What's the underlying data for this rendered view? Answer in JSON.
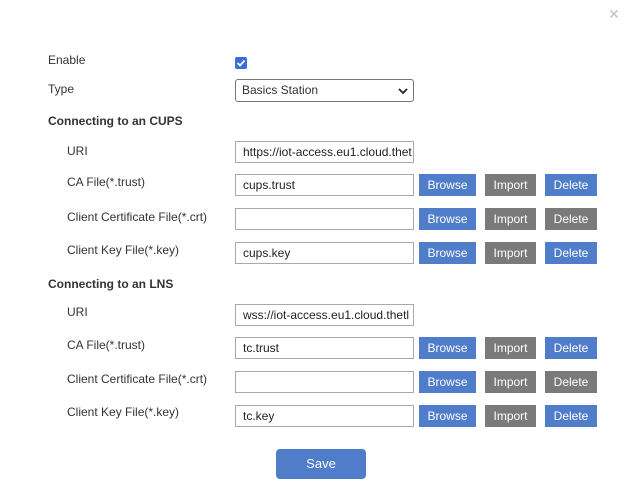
{
  "form": {
    "enable_label": "Enable",
    "enable_checked": true,
    "type_label": "Type",
    "type_value": "Basics Station",
    "cups": {
      "title": "Connecting to an CUPS",
      "uri_label": "URI",
      "uri_value": "https://iot-access.eu1.cloud.thet",
      "ca_label": "CA File(*.trust)",
      "ca_value": "cups.trust",
      "cert_label": "Client Certificate File(*.crt)",
      "cert_value": "",
      "key_label": "Client Key File(*.key)",
      "key_value": "cups.key"
    },
    "lns": {
      "title": "Connecting to an LNS",
      "uri_label": "URI",
      "uri_value": "wss://iot-access.eu1.cloud.thetl",
      "ca_label": "CA File(*.trust)",
      "ca_value": "tc.trust",
      "cert_label": "Client Certificate File(*.crt)",
      "cert_value": "",
      "key_label": "Client Key File(*.key)",
      "key_value": "tc.key"
    }
  },
  "buttons": {
    "browse": "Browse",
    "import": "Import",
    "delete": "Delete",
    "save": "Save"
  },
  "icons": {
    "close": "close-icon",
    "checkbox": "check-icon",
    "dropdown": "chevron-down-icon"
  },
  "colors": {
    "primary": "#4f7dc9",
    "secondary": "#7a7a7a",
    "checkbox": "#3b6fd8"
  }
}
